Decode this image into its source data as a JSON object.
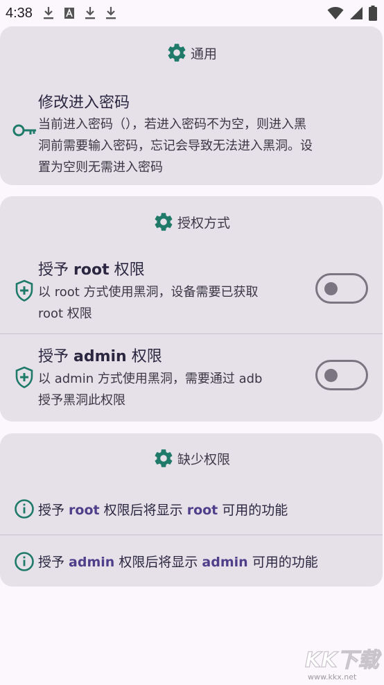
{
  "status_bar": {
    "time": "4:38",
    "left_icons": [
      "download-icon",
      "a-box-icon",
      "download-icon",
      "download-icon"
    ],
    "right_icons": [
      "wifi-icon",
      "signal-icon",
      "battery-icon"
    ]
  },
  "sections": {
    "general": {
      "header": "通用",
      "row": {
        "title": "修改进入密码",
        "desc_line1": "当前进入密码（），若进入密码不为空，则进入黑",
        "desc_line2": "洞前需要输入密码，忘记会导致无法进入黑洞。设",
        "desc_line3": "置为空则无需进入密码"
      }
    },
    "auth": {
      "header": "授权方式",
      "root": {
        "title_pre": "授予 ",
        "title_bold": "root",
        "title_post": " 权限",
        "desc_line1": "以 root 方式使用黑洞，设备需要已获取",
        "desc_line2": "root 权限",
        "enabled": false
      },
      "admin": {
        "title_pre": "授予 ",
        "title_bold": "admin",
        "title_post": " 权限",
        "desc_line1": "以 admin 方式使用黑洞，需要通过 adb",
        "desc_line2": "授予黑洞此权限",
        "enabled": false
      }
    },
    "missing": {
      "header": "缺少权限",
      "root_pre": "授予 ",
      "root_bold": "root",
      "root_mid": " 权限后将显示 ",
      "root_bold2": "root",
      "root_post": " 可用的功能",
      "admin_pre": "授予 ",
      "admin_bold": "admin",
      "admin_mid": " 权限后将显示 ",
      "admin_bold2": "admin",
      "admin_post": " 可用的功能"
    }
  },
  "colors": {
    "accent_teal": "#1f7a6a",
    "card_bg": "#e6e1e8",
    "page_bg": "#fcf7fd",
    "toggle_off": "#7a7580"
  },
  "watermark": {
    "logo_text": "KK下载",
    "url": "www.kkx.net"
  }
}
